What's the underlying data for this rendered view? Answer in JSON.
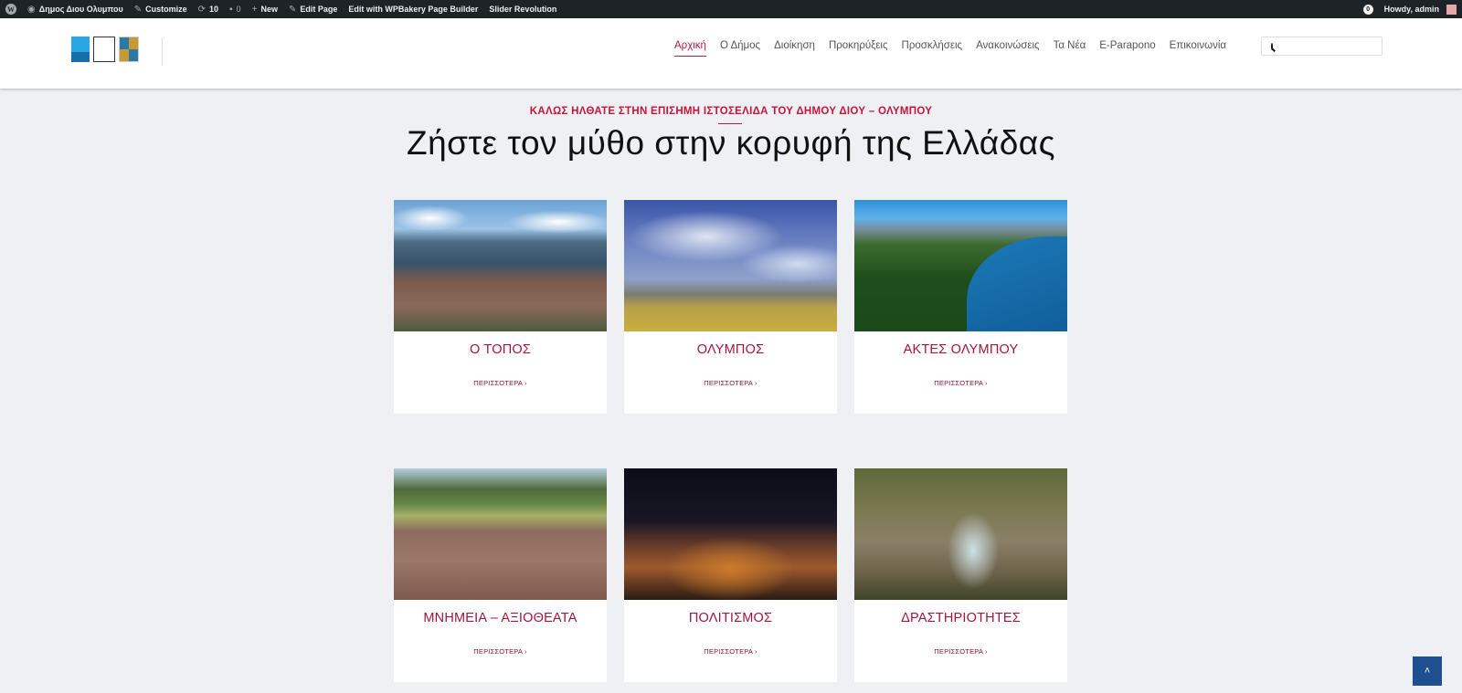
{
  "adminbar": {
    "site_name": "Δημος Διου Ολυμπου",
    "customize": "Customize",
    "updates": "10",
    "comments": "0",
    "new": "New",
    "edit_page": "Edit Page",
    "wpbakery": "Edit with WPBakery Page Builder",
    "slider": "Slider Revolution",
    "notifications": "0",
    "howdy": "Howdy, admin"
  },
  "nav": {
    "items": [
      "Αρχική",
      "Ο Δήμος",
      "Διοίκηση",
      "Προκηρύξεις",
      "Προσκλήσεις",
      "Ανακοινώσεις",
      "Τα Νέα",
      "E-Paraponο",
      "Επικοινωνία"
    ]
  },
  "search": {
    "placeholder": ""
  },
  "hero": {
    "subtitle": "ΚΑΛΩΣ ΗΛΘΑΤΕ ΣΤΗΝ ΕΠΙΣΗΜΗ ΙΣΤΟΣΕΛΙΔΑ ΤΟΥ ΔΗΜΟΥ ΔΙΟΥ – ΟΛΥΜΠΟΥ",
    "title": "Ζήστε τον μύθο στην κορυφή της Ελλάδας"
  },
  "cards": [
    {
      "title": "Ο ΤΟΠΟΣ",
      "more": "ΠΕΡΙΣΣΟΤΕΡΑ ›"
    },
    {
      "title": "ΟΛΥΜΠΟΣ",
      "more": "ΠΕΡΙΣΣΟΤΕΡΑ ›"
    },
    {
      "title": "ΑΚΤΕΣ ΟΛΥΜΠΟΥ",
      "more": "ΠΕΡΙΣΣΟΤΕΡΑ ›"
    },
    {
      "title": "ΜΝΗΜΕΙΑ – ΑΞΙΟΘΕΑΤΑ",
      "more": "ΠΕΡΙΣΣΟΤΕΡΑ ›"
    },
    {
      "title": "ΠΟΛΙΤΙΣΜΟΣ",
      "more": "ΠΕΡΙΣΣΟΤΕΡΑ ›"
    },
    {
      "title": "ΔΡΑΣΤΗΡΙΟΤΗΤΕΣ",
      "more": "ΠΕΡΙΣΣΟΤΕΡΑ ›"
    }
  ],
  "colors": {
    "accent": "#c4153b",
    "adminbar": "#1d2327",
    "to_top": "#1d4f91"
  },
  "icons": {
    "to_top": "chevron-up-icon",
    "search": "search-icon"
  }
}
